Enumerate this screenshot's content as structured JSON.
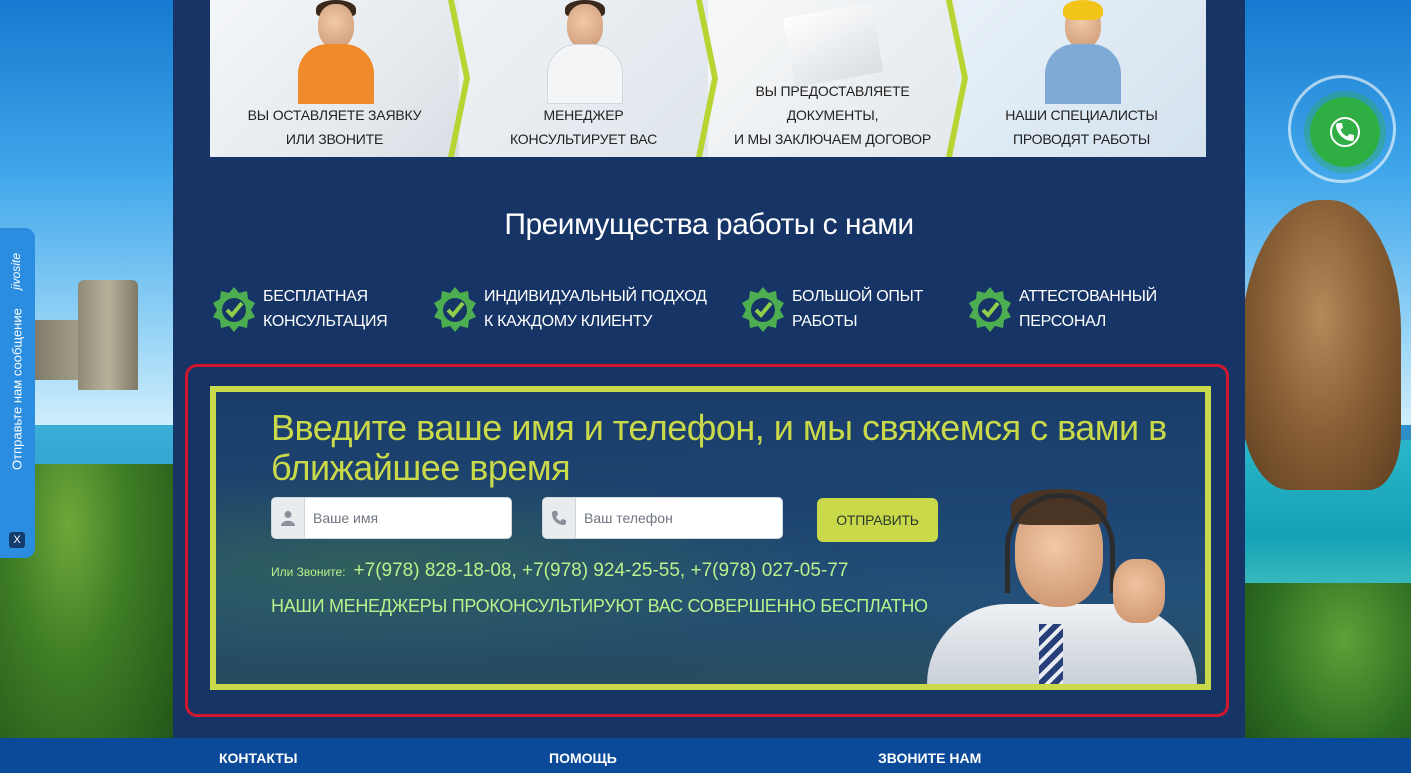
{
  "steps": [
    {
      "line1": "Вы оставляете заявку",
      "line2": "или звоните"
    },
    {
      "line1": "Менеджер",
      "line2": "консультирует вас"
    },
    {
      "line1": "Вы предоставляете документы,",
      "line2": "и мы заключаем договор"
    },
    {
      "line1": "Наши специалисты",
      "line2": "проводят работы"
    }
  ],
  "advantages": {
    "title": "Преимущества работы с нами",
    "items": [
      {
        "line1": "Бесплатная",
        "line2": "консультация"
      },
      {
        "line1": "Индивидуальный подход",
        "line2": "к каждому клиенту"
      },
      {
        "line1": "Большой опыт",
        "line2": "работы"
      },
      {
        "line1": "Аттестованный",
        "line2": "персонал"
      }
    ]
  },
  "form": {
    "title": "Введите ваше имя и телефон, и мы свяжемся с вами в ближайшее время",
    "name_placeholder": "Ваше имя",
    "phone_placeholder": "Ваш телефон",
    "submit_label": "Отправить",
    "call_label": "Или Звоните:",
    "phones": "+7(978) 828-18-08, +7(978) 924-25-55, +7(978) 027-05-77",
    "note": "Наши менеджеры проконсультируют вас совершенно бесплатно"
  },
  "footer": {
    "contacts": "Контакты",
    "help": "Помощь",
    "call_us": "Звоните нам"
  },
  "jivosite": {
    "brand": "jivosite",
    "message": "Отправьте нам сообщение",
    "close": "X"
  },
  "colors": {
    "accent": "#c9d94a",
    "highlight_border": "#d0172b",
    "panel": "#163566",
    "footer": "#0b4a99",
    "call_button": "#2fae44"
  },
  "icons": [
    "user-icon",
    "phone-icon",
    "check-badge-icon",
    "handset-icon"
  ]
}
